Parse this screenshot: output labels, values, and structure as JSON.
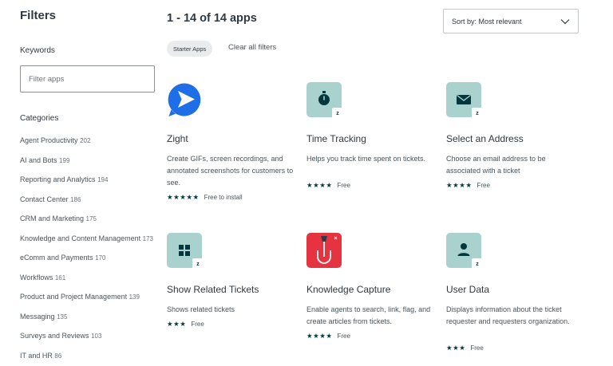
{
  "sidebar": {
    "title": "Filters",
    "keywords_label": "Keywords",
    "filter_placeholder": "Filter apps",
    "categories_label": "Categories",
    "categories": [
      {
        "name": "Agent Productivity",
        "count": "202"
      },
      {
        "name": "AI and Bots",
        "count": "199"
      },
      {
        "name": "Reporting and Analytics",
        "count": "194"
      },
      {
        "name": "Contact Center",
        "count": "186"
      },
      {
        "name": "CRM and Marketing",
        "count": "175"
      },
      {
        "name": "Knowledge and Content Management",
        "count": "173"
      },
      {
        "name": "eComm and Payments",
        "count": "170"
      },
      {
        "name": "Workflows",
        "count": "161"
      },
      {
        "name": "Product and Project Management",
        "count": "139"
      },
      {
        "name": "Messaging",
        "count": "135"
      },
      {
        "name": "Surveys and Reviews",
        "count": "103"
      },
      {
        "name": "IT and HR",
        "count": "86"
      }
    ]
  },
  "header": {
    "results": "1 - 14 of 14 apps",
    "sort_label": "Sort by: Most relevant",
    "chip": "Starter Apps",
    "clear_filters": "Clear all filters"
  },
  "apps": [
    {
      "name": "Zight",
      "desc": "Create GIFs, screen recordings, and annotated screenshots for customers to see.",
      "stars": "★★★★★",
      "rating": 5,
      "price": "Free to install",
      "icon": "play-arrow-icon",
      "color": "#1e6ee8"
    },
    {
      "name": "Time Tracking",
      "desc": "Helps you track time spent on tickets.",
      "stars": "★★★★",
      "rating": 4,
      "price": "Free",
      "icon": "stopwatch-icon",
      "color": "#a9d2ce"
    },
    {
      "name": "Select an Address",
      "desc": "Choose an email address to be associated with a ticket",
      "stars": "★★★★",
      "rating": 4,
      "price": "Free",
      "icon": "envelope-icon",
      "color": "#a9d2ce"
    },
    {
      "name": "Show Related Tickets",
      "desc": "Shows related tickets",
      "stars": "★★★",
      "rating": 3,
      "price": "Free",
      "icon": "grid-icon",
      "color": "#a9d2ce"
    },
    {
      "name": "Knowledge Capture",
      "desc": "Enable agents to search, link, flag, and create articles from tickets.",
      "stars": "★★★★",
      "rating": 4,
      "price": "Free",
      "icon": "hook-icon",
      "color": "#e5343f"
    },
    {
      "name": "User Data",
      "desc": "Displays information about the ticket requester and requesters organization.",
      "stars": "★★★",
      "rating": 3,
      "price": "Free",
      "icon": "person-icon",
      "color": "#a9d2ce"
    }
  ],
  "colors": {
    "accent": "#03363d",
    "text": "#2f3941",
    "tile_green": "#a9d2ce",
    "zight_blue": "#1e6ee8",
    "kc_red": "#e5343f"
  }
}
